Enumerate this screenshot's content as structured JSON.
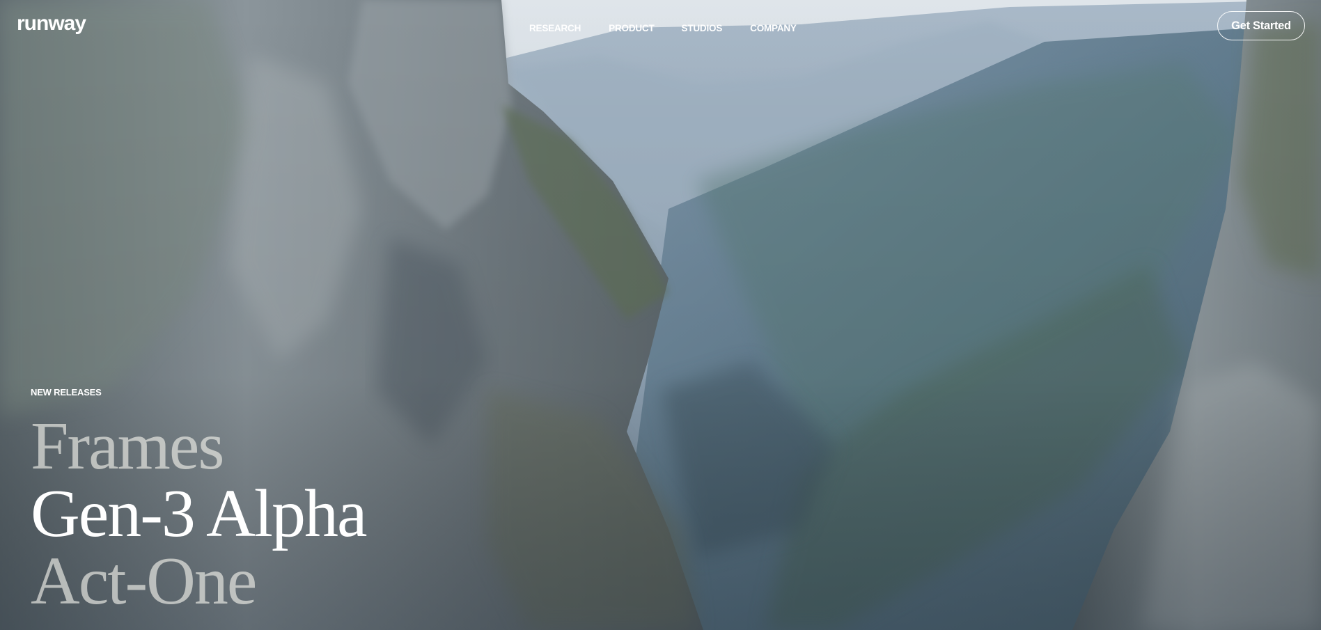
{
  "brand": {
    "logo_text": "runway"
  },
  "nav": {
    "items": [
      {
        "label": "RESEARCH"
      },
      {
        "label": "PRODUCT"
      },
      {
        "label": "STUDIOS"
      },
      {
        "label": "COMPANY"
      }
    ],
    "cta_label": "Get Started"
  },
  "hero": {
    "background": "mountain-canyon-video-still",
    "eyebrow": "NEW RELEASES",
    "releases": [
      {
        "label": "Frames",
        "state": "dim"
      },
      {
        "label": "Gen-3 Alpha",
        "state": "active"
      },
      {
        "label": "Act-One",
        "state": "dim"
      }
    ]
  },
  "colors": {
    "text": "#ffffff",
    "dim_text": "#c9c9c0",
    "sky": "#cfd8e0",
    "rock": "#6f7a82"
  }
}
